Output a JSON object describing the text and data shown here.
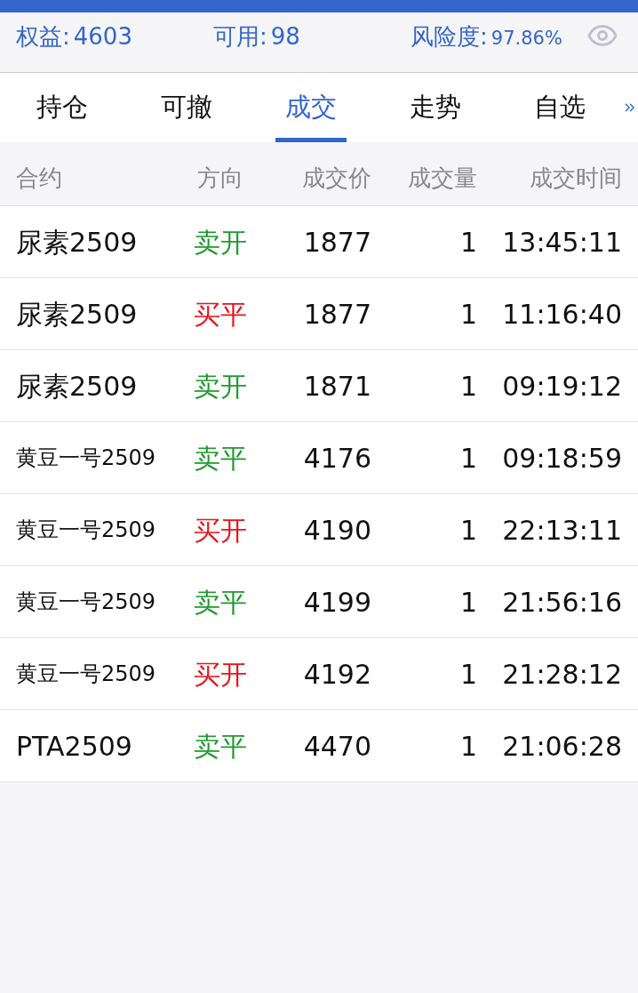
{
  "summary": {
    "equity": {
      "label": "权益:",
      "value": "4603"
    },
    "available": {
      "label": "可用:",
      "value": "98"
    },
    "risk": {
      "label": "风险度:",
      "value": "97.86%"
    }
  },
  "tabs": [
    {
      "label": "持仓",
      "selected": false
    },
    {
      "label": "可撤",
      "selected": false
    },
    {
      "label": "成交",
      "selected": true
    },
    {
      "label": "走势",
      "selected": false
    },
    {
      "label": "自选",
      "selected": false
    }
  ],
  "table": {
    "columns": [
      "合约",
      "方向",
      "成交价",
      "成交量",
      "成交时间"
    ],
    "rows": [
      {
        "contract": "尿素2509",
        "direction": {
          "text": "卖开",
          "color": "#1f9a2e"
        },
        "price": "1877",
        "quantity": "1",
        "time": "13:45:11"
      },
      {
        "contract": "尿素2509",
        "direction": {
          "text": "买平",
          "color": "#e5141b"
        },
        "price": "1877",
        "quantity": "1",
        "time": "11:16:40"
      },
      {
        "contract": "尿素2509",
        "direction": {
          "text": "卖开",
          "color": "#1f9a2e"
        },
        "price": "1871",
        "quantity": "1",
        "time": "09:19:12"
      },
      {
        "contract": "黄豆一号2509",
        "direction": {
          "text": "卖平",
          "color": "#1f9a2e"
        },
        "price": "4176",
        "quantity": "1",
        "time": "09:18:59"
      },
      {
        "contract": "黄豆一号2509",
        "direction": {
          "text": "买开",
          "color": "#e5141b"
        },
        "price": "4190",
        "quantity": "1",
        "time": "22:13:11"
      },
      {
        "contract": "黄豆一号2509",
        "direction": {
          "text": "卖平",
          "color": "#1f9a2e"
        },
        "price": "4199",
        "quantity": "1",
        "time": "21:56:16"
      },
      {
        "contract": "黄豆一号2509",
        "direction": {
          "text": "买开",
          "color": "#e5141b"
        },
        "price": "4192",
        "quantity": "1",
        "time": "21:28:12"
      },
      {
        "contract": "PTA2509",
        "direction": {
          "text": "卖平",
          "color": "#1f9a2e"
        },
        "price": "4470",
        "quantity": "1",
        "time": "21:06:28"
      }
    ]
  }
}
